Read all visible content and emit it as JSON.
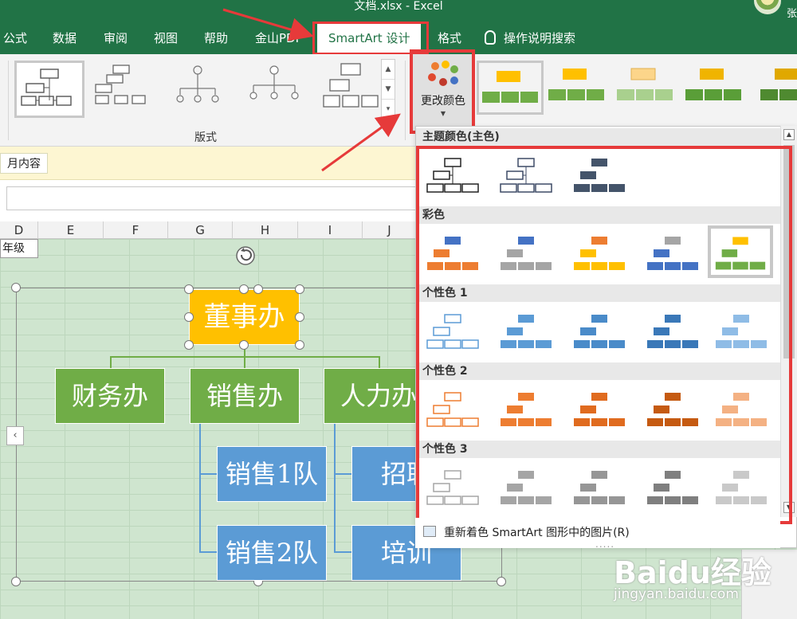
{
  "window": {
    "title": "文档.xlsx  -  Excel",
    "user": "张"
  },
  "tabs": [
    {
      "label": "公式"
    },
    {
      "label": "数据"
    },
    {
      "label": "审阅"
    },
    {
      "label": "视图"
    },
    {
      "label": "帮助"
    },
    {
      "label": "金山PDF"
    },
    {
      "label": "SmartArt 设计"
    },
    {
      "label": "格式"
    }
  ],
  "tell_me": "操作说明搜索",
  "ribbon": {
    "layouts_group_label": "版式",
    "change_colors_label": "更改颜色",
    "accent_colors": [
      "#ed7d31",
      "#a5a5a5",
      "#ffc000",
      "#5b9bd5",
      "#70ad47"
    ]
  },
  "info_bar": {
    "text": "月内容"
  },
  "sheet": {
    "columns": [
      "D",
      "E",
      "F",
      "G",
      "H",
      "I",
      "J"
    ],
    "cell_d": "年级"
  },
  "smartart": {
    "top": "董事办",
    "level2": [
      "财务办",
      "销售办",
      "人力办"
    ],
    "level3": [
      "销售1队",
      "销售2队",
      "招聘",
      "培训"
    ],
    "colors": {
      "top": "#ffc000",
      "level2": "#70ad47",
      "level3": "#5b9bd5"
    }
  },
  "color_dropdown": {
    "sections": [
      {
        "label": "主题颜色(主色)"
      },
      {
        "label": "彩色"
      },
      {
        "label": "个性色 1"
      },
      {
        "label": "个性色 2"
      },
      {
        "label": "个性色 3"
      }
    ],
    "recolor_label": "重新着色 SmartArt 图形中的图片(R)",
    "grip": "....."
  },
  "watermark": {
    "brand": "Baidu经验",
    "url": "jingyan.baidu.com"
  }
}
